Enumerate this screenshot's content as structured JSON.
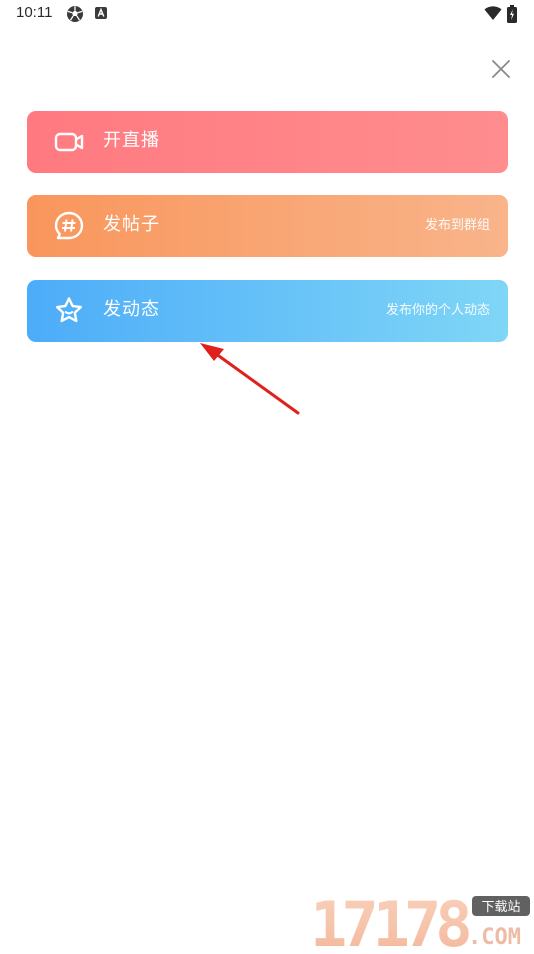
{
  "status_bar": {
    "time": "10:11",
    "left_icons": [
      "soccer-ball-icon",
      "app-a-icon"
    ],
    "right_icons": [
      "wifi-icon",
      "battery-charging-icon"
    ]
  },
  "close_icon": "close-icon",
  "actions": [
    {
      "key": "live",
      "icon": "video-camera-icon",
      "title": "开直播",
      "subtitle": "",
      "color_start": "#ff7a80",
      "color_end": "#ff8d8e"
    },
    {
      "key": "post",
      "icon": "hashtag-bubble-icon",
      "title": "发帖子",
      "subtitle": "发布到群组",
      "color_start": "#f9965c",
      "color_end": "#f9b48a"
    },
    {
      "key": "moment",
      "icon": "star-face-icon",
      "title": "发动态",
      "subtitle": "发布你的个人动态",
      "color_start": "#4dacf8",
      "color_end": "#7fd6f7"
    }
  ],
  "annotation": {
    "icon": "red-arrow-icon",
    "color": "#e0201c"
  },
  "watermark": {
    "text": "17178",
    "badge": "下载站",
    "domain": ".COM"
  }
}
